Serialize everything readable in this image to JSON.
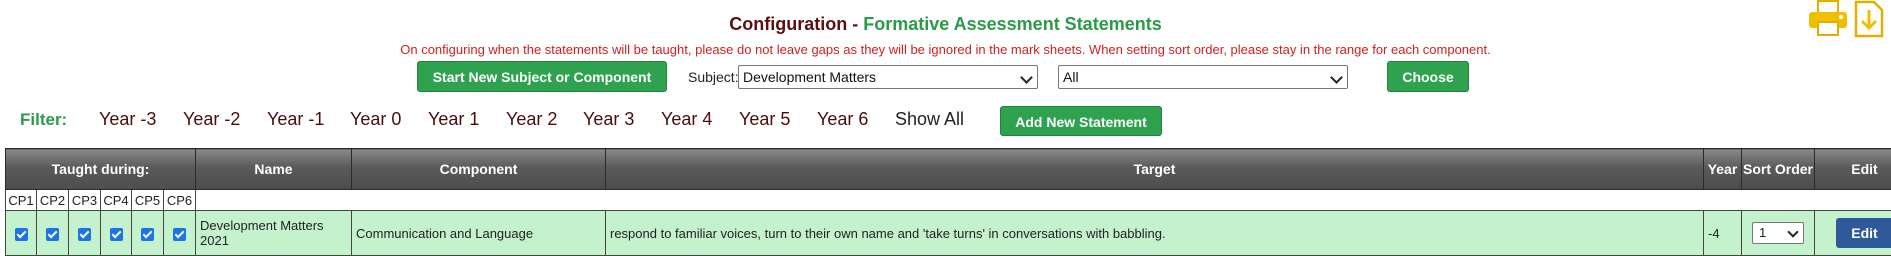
{
  "header": {
    "title_prefix": "Configuration - ",
    "title_accent": "Formative Assessment Statements",
    "notice": "On configuring when the statements will be taught, please do not leave gaps as they will be ignored in the mark sheets. When setting sort order, please stay in the range for each component.",
    "icons": [
      "printer-icon",
      "download-icon"
    ]
  },
  "toolbar": {
    "start_new_label": "Start New Subject or Component",
    "subject_label": "Subject:",
    "subject_value": "Development Matters",
    "component_value": "All",
    "choose_label": "Choose"
  },
  "filter": {
    "label": "Filter:",
    "items": [
      "Year -3",
      "Year -2",
      "Year -1",
      "Year 0",
      "Year 1",
      "Year 2",
      "Year 3",
      "Year 4",
      "Year 5",
      "Year 6",
      "Show All"
    ],
    "add_label": "Add New Statement"
  },
  "table": {
    "headers": {
      "taught_during": "Taught during:",
      "name": "Name",
      "component": "Component",
      "target": "Target",
      "year": "Year",
      "sort_order": "Sort Order",
      "edit": "Edit"
    },
    "cp_labels": [
      "CP1",
      "CP2",
      "CP3",
      "CP4",
      "CP5",
      "CP6"
    ],
    "rows": [
      {
        "name": "Development Matters 2021",
        "component": "Communication and Language",
        "target": "respond to familiar voices, turn to their own name and 'take turns' in conversations with babbling.",
        "year": "-4",
        "sort_order": "1",
        "edit_label": "Edit",
        "checked": [
          true,
          true,
          true,
          true,
          true,
          true
        ]
      }
    ]
  },
  "colors": {
    "title": "#5c0f0f",
    "accent": "#2a9b48",
    "notice": "#d02020",
    "button_green": "#2ea24f",
    "row_bg": "#c3f2cd",
    "edit_blue": "#2f5a9a"
  }
}
